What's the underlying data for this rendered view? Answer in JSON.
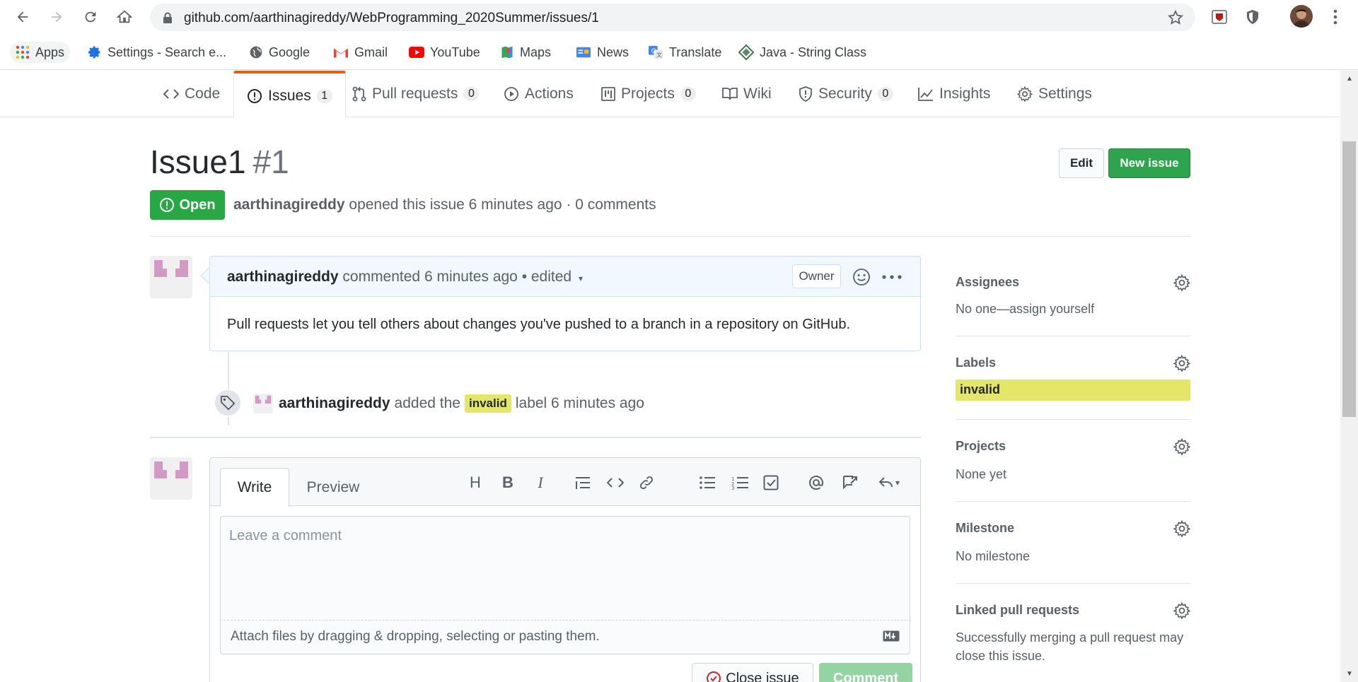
{
  "browser": {
    "url": "github.com/aarthinagireddy/WebProgramming_2020Summer/issues/1",
    "bookmarks": [
      {
        "label": "Apps",
        "icon": "apps-grid-icon"
      },
      {
        "label": "Settings - Search e...",
        "icon": "gear-icon"
      },
      {
        "label": "Google",
        "icon": "globe-icon"
      },
      {
        "label": "Gmail",
        "icon": "gmail-icon"
      },
      {
        "label": "YouTube",
        "icon": "youtube-icon"
      },
      {
        "label": "Maps",
        "icon": "maps-icon"
      },
      {
        "label": "News",
        "icon": "news-icon"
      },
      {
        "label": "Translate",
        "icon": "translate-icon"
      },
      {
        "label": "Java - String Class",
        "icon": "diamond-icon"
      }
    ]
  },
  "repo_nav": {
    "tabs": [
      {
        "label": "Code",
        "icon": "code-icon",
        "count": ""
      },
      {
        "label": "Issues",
        "icon": "issue-icon",
        "count": "1"
      },
      {
        "label": "Pull requests",
        "icon": "pull-request-icon",
        "count": "0"
      },
      {
        "label": "Actions",
        "icon": "play-icon",
        "count": ""
      },
      {
        "label": "Projects",
        "icon": "project-icon",
        "count": "0"
      },
      {
        "label": "Wiki",
        "icon": "book-icon",
        "count": ""
      },
      {
        "label": "Security",
        "icon": "shield-icon",
        "count": "0"
      },
      {
        "label": "Insights",
        "icon": "graph-icon",
        "count": ""
      },
      {
        "label": "Settings",
        "icon": "gear-icon",
        "count": ""
      }
    ],
    "selected": "Issues"
  },
  "issue": {
    "title": "Issue1",
    "number": "#1",
    "edit_label": "Edit",
    "new_issue_label": "New issue",
    "state": "Open",
    "author": "aarthinagireddy",
    "meta_rest": "opened this issue 6 minutes ago · 0 comments"
  },
  "comment": {
    "author": "aarthinagireddy",
    "meta": "commented 6 minutes ago • edited",
    "role": "Owner",
    "body": "Pull requests let you tell others about changes you've pushed to a branch in a repository on GitHub."
  },
  "event": {
    "actor": "aarthinagireddy",
    "text_before": "added the",
    "label": "invalid",
    "text_after": "label 6 minutes ago",
    "label_color": "#e4e669"
  },
  "form": {
    "write_tab": "Write",
    "preview_tab": "Preview",
    "placeholder": "Leave a comment",
    "attach_text": "Attach files by dragging & dropping, selecting or pasting them.",
    "close_label": "Close issue",
    "comment_label": "Comment"
  },
  "sidebar": {
    "assignees_title": "Assignees",
    "assignees_value": "No one—assign yourself",
    "labels_title": "Labels",
    "labels_value": "invalid",
    "projects_title": "Projects",
    "projects_value": "None yet",
    "milestone_title": "Milestone",
    "milestone_value": "No milestone",
    "linked_title": "Linked pull requests",
    "linked_value_1": "Successfully merging a pull request may",
    "linked_value_2": "close this issue."
  },
  "colors": {
    "accent_tab": "#e36209",
    "open_green": "#28a745",
    "button_green": "#2ea44f",
    "label_invalid": "#e4e669"
  }
}
